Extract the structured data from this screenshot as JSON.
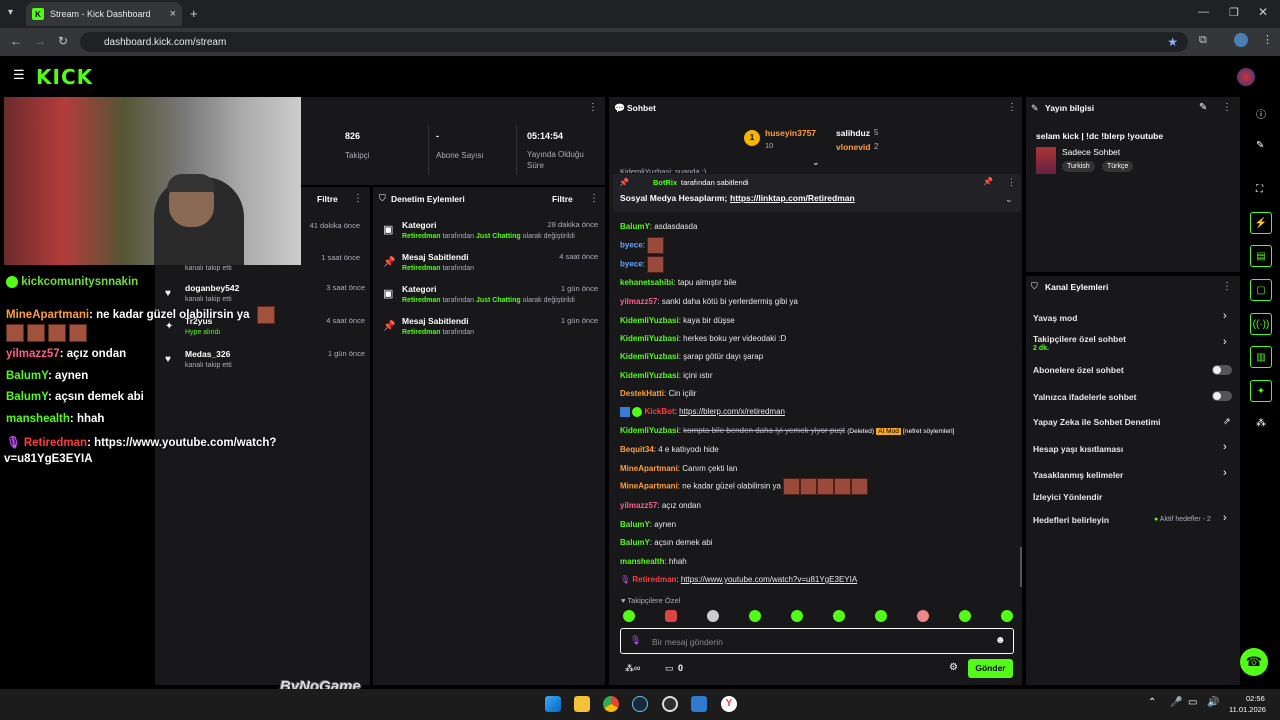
{
  "browser": {
    "tab_title": "Stream - Kick Dashboard",
    "url": "dashboard.kick.com/stream"
  },
  "header": {
    "logo": "KICK"
  },
  "stats": [
    {
      "value": "826",
      "label": "Takipçi"
    },
    {
      "value": "-",
      "label": "Abone Sayısı"
    },
    {
      "value": "05:14:54",
      "label": "Yayında Olduğu Süre"
    }
  ],
  "activity_panel": {
    "filter_label": "Filtre",
    "items": [
      {
        "name": "",
        "action": "",
        "time": "41 dakika önce"
      },
      {
        "name": "",
        "action": "kanalı takip etti",
        "time": "1 saat önce"
      },
      {
        "name": "doganbey542",
        "action": "kanalı takip etti",
        "time": "3 saat önce"
      },
      {
        "name": "Tr2yus",
        "action": "Hype alındı",
        "time": "4 saat önce"
      },
      {
        "name": "Medas_326",
        "action": "kanalı takip etti",
        "time": "1 gün önce"
      }
    ]
  },
  "mod_panel": {
    "title": "Denetim Eylemleri",
    "filter_label": "Filtre",
    "items": [
      {
        "title": "Kategori",
        "actor": "Retiredman",
        "mid": " tarafından ",
        "target": "Just Chatting",
        "tail": " olarak değiştirildi",
        "time": "28 dakika önce"
      },
      {
        "title": "Mesaj Sabitlendi",
        "actor": "Retiredman",
        "mid": " tarafından",
        "target": "",
        "tail": "",
        "time": "4 saat önce"
      },
      {
        "title": "Kategori",
        "actor": "Retiredman",
        "mid": " tarafından ",
        "target": "Just Chatting",
        "tail": " olarak değiştirildi",
        "time": "1 gün önce"
      },
      {
        "title": "Mesaj Sabitlendi",
        "actor": "Retiredman",
        "mid": " tarafından",
        "target": "",
        "tail": "",
        "time": "1 gün önce"
      }
    ]
  },
  "overlay_chat": {
    "header": "kickcomunitysnnakin",
    "lines": [
      {
        "user": "MineApartmani",
        "msg": ": ne kadar güzel olabilirsin ya",
        "color": "#ff9e3d"
      },
      {
        "user": "yilmazz57",
        "msg": ": açız ondan",
        "color": "#ff5c8a"
      },
      {
        "user": "BalumY",
        "msg": ": aynen",
        "color": "#53fc18"
      },
      {
        "user": "BalumY",
        "msg": ": açsın demek abi",
        "color": "#53fc18"
      },
      {
        "user": "manshealth",
        "msg": ": hhah",
        "color": "#53fc18"
      },
      {
        "user": "Retiredman",
        "msg": ": https://www.youtube.com/watch?",
        "color": "#ff3b3b"
      }
    ],
    "wrap": "v=u81YgE3EYIA",
    "watermark": "ByNoGame"
  },
  "chat": {
    "title": "Sohbet",
    "top_gifters": [
      {
        "name": "huseyin3757",
        "count": "10"
      },
      {
        "name": "salihduz",
        "count": "5"
      },
      {
        "name": "vlonevid",
        "count": "2"
      }
    ],
    "partial_line": "KidemliYuzbasi: suanda :)",
    "pinned": {
      "by_user": "BotRix",
      "by_text": "tarafından sabitlendi",
      "message": "Sosyal Medya Hesaplarım; ",
      "link": "https://linktap.com/Retiredman"
    },
    "messages": [
      {
        "user": "BalumY",
        "text": "asdasdasda",
        "color": "#53fc18"
      },
      {
        "user": "byece",
        "text": "",
        "color": "#5fa8ff"
      },
      {
        "user": "byece",
        "text": "",
        "color": "#5fa8ff"
      },
      {
        "user": "kehanetsahibi",
        "text": "tapu almıştır bile",
        "color": "#53fc18"
      },
      {
        "user": "yilmazz57",
        "text": "sanki daha kötü bi yerlerdermiş gibi ya",
        "color": "#ff5c8a"
      },
      {
        "user": "KidemliYuzbasi",
        "text": "kaya bir düşse",
        "color": "#53fc18"
      },
      {
        "user": "KidemliYuzbasi",
        "text": "herkes boku yer videodaki :D",
        "color": "#53fc18"
      },
      {
        "user": "KidemliYuzbasi",
        "text": "şarap götür dayı şarap",
        "color": "#53fc18"
      },
      {
        "user": "KidemliYuzbasi",
        "text": "içini ıstır",
        "color": "#53fc18"
      },
      {
        "user": "DestekHatti",
        "text": "Cin içilir",
        "color": "#ff9e3d"
      },
      {
        "user": "KickBot",
        "text": "https://blerp.com/x/retiredman",
        "color": "#ff3b3b"
      },
      {
        "user": "KidemliYuzbasi",
        "text": "kompta bile benden daha iyi yemek yiyor puşt",
        "color": "#53fc18"
      },
      {
        "user": "Bequit34",
        "text": "4 e katlıyodı hide",
        "color": "#ff9e3d"
      },
      {
        "user": "MineApartmani",
        "text": "Canım çekti lan",
        "color": "#ff9e3d"
      },
      {
        "user": "MineApartmani",
        "text": "ne kadar güzel olabilirsin ya",
        "color": "#ff9e3d"
      },
      {
        "user": "yilmazz57",
        "text": "açız ondan",
        "color": "#ff5c8a"
      },
      {
        "user": "BalumY",
        "text": "aynen",
        "color": "#53fc18"
      },
      {
        "user": "BalumY",
        "text": "açsın demek abi",
        "color": "#53fc18"
      },
      {
        "user": "manshealth",
        "text": "hhah",
        "color": "#53fc18"
      },
      {
        "user": "Retiredman",
        "text": "https://www.youtube.com/watch?v=u81YgE3EYIA",
        "color": "#ff3b3b"
      }
    ],
    "deleted_tag": "(Deleted)",
    "ai_tag": "AI Mod",
    "hate_tag": "[nefret söylemleri]",
    "followers_only": "Takipçilere Özel",
    "input_placeholder": "Bir mesaj gönderin",
    "points": "0",
    "send_label": "Gönder"
  },
  "stream_info": {
    "title": "Yayın bilgisi",
    "stream_title": "selam kick | !dc !blerp !youtube",
    "category": "Sadece Sohbet",
    "tags": [
      "Turkish",
      "Türkçe"
    ]
  },
  "channel_actions": {
    "title": "Kanal Eylemleri",
    "items": [
      {
        "label": "Yavaş mod",
        "sub": "",
        "right": ""
      },
      {
        "label": "Takipçilere özel sohbet",
        "sub": "2 dk.",
        "right": ""
      },
      {
        "label": "Abonelere özel sohbet",
        "sub": "",
        "right": ""
      },
      {
        "label": "Yalnızca ifadelerle sohbet",
        "sub": "",
        "right": ""
      },
      {
        "label": "Yapay Zeka ile Sohbet Denetimi",
        "sub": "",
        "right": ""
      },
      {
        "label": "Hesap yaşı kısıtlaması",
        "sub": "",
        "right": ""
      },
      {
        "label": "Yasaklanmış kelimeler",
        "sub": "",
        "right": ""
      },
      {
        "label": "İzleyici Yönlendir",
        "sub": "",
        "right": ""
      },
      {
        "label": "Hedefleri belirleyin",
        "sub": "",
        "right": "Aktif hedefler - 2"
      }
    ]
  },
  "taskbar": {
    "time": "02:56",
    "date": "11.01.2026"
  },
  "colors": {
    "accent": "#53fc18",
    "panel": "#18181b",
    "bg": "#000000"
  }
}
